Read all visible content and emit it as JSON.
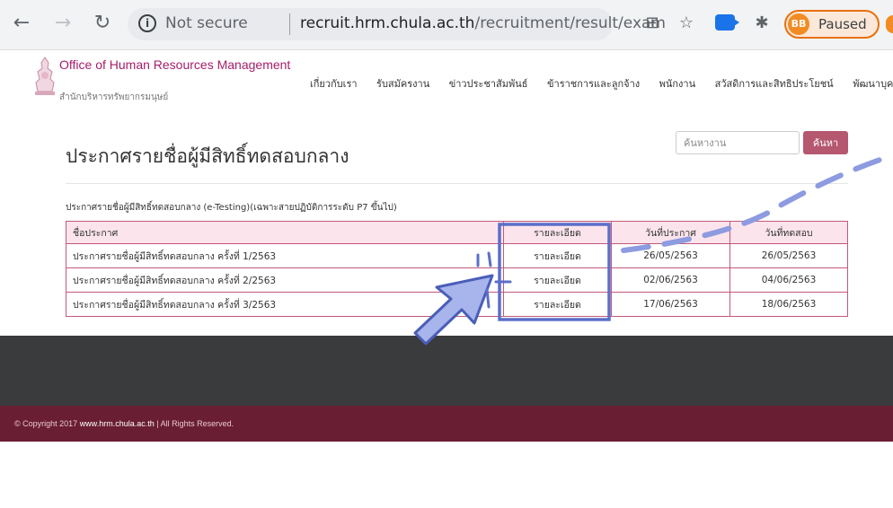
{
  "browser": {
    "security_label": "Not secure",
    "url_host": "recruit.hrm.chula.ac.th",
    "url_path": "/recruitment/result/exam",
    "profile_initials": "BB",
    "profile_status": "Paused"
  },
  "site": {
    "title_en": "Office of Human Resources Management",
    "title_th": "สำนักบริหารทรัพยากรมนุษย์",
    "nav": [
      {
        "label": "เกี่ยวกับเรา"
      },
      {
        "label": "รับสมัครงาน"
      },
      {
        "label": "ข่าวประชาสัมพันธ์"
      },
      {
        "label": "ข้าราชการและลูกจ้าง"
      },
      {
        "label": "พนักงาน"
      },
      {
        "label": "สวัสดิการและสิทธิประโยชน์"
      },
      {
        "label": "พัฒนาบุคลากร"
      }
    ]
  },
  "main": {
    "title": "ประกาศรายชื่อผู้มีสิทธิ์ทดสอบกลาง",
    "search_placeholder": "ค้นหางาน",
    "search_button": "ค้นหา",
    "subtitle": "ประกาศรายชื่อผู้มีสิทธิ์ทดสอบกลาง (e-Testing)(เฉพาะสายปฏิบัติการระดับ P7 ขึ้นไป)",
    "table": {
      "headers": [
        "ชื่อประกาศ",
        "รายละเอียด",
        "วันที่ประกาศ",
        "วันที่ทดสอบ"
      ],
      "rows": [
        {
          "name": "ประกาศรายชื่อผู้มีสิทธิ์ทดสอบกลาง ครั้งที่ 1/2563",
          "detail": "รายละเอียด",
          "announced": "26/05/2563",
          "exam": "26/05/2563"
        },
        {
          "name": "ประกาศรายชื่อผู้มีสิทธิ์ทดสอบกลาง ครั้งที่ 2/2563",
          "detail": "รายละเอียด",
          "announced": "02/06/2563",
          "exam": "04/06/2563"
        },
        {
          "name": "ประกาศรายชื่อผู้มีสิทธิ์ทดสอบกลาง ครั้งที่ 3/2563",
          "detail": "รายละเอียด",
          "announced": "17/06/2563",
          "exam": "18/06/2563"
        }
      ]
    }
  },
  "footer": {
    "copyright_prefix": "© Copyright 2017",
    "copyright_link": "www.hrm.chula.ac.th",
    "copyright_suffix": "| All Rights Reserved."
  },
  "colors": {
    "brand": "#a61d6a",
    "table_border": "#c25979",
    "annotation": "#5a6fc9"
  }
}
